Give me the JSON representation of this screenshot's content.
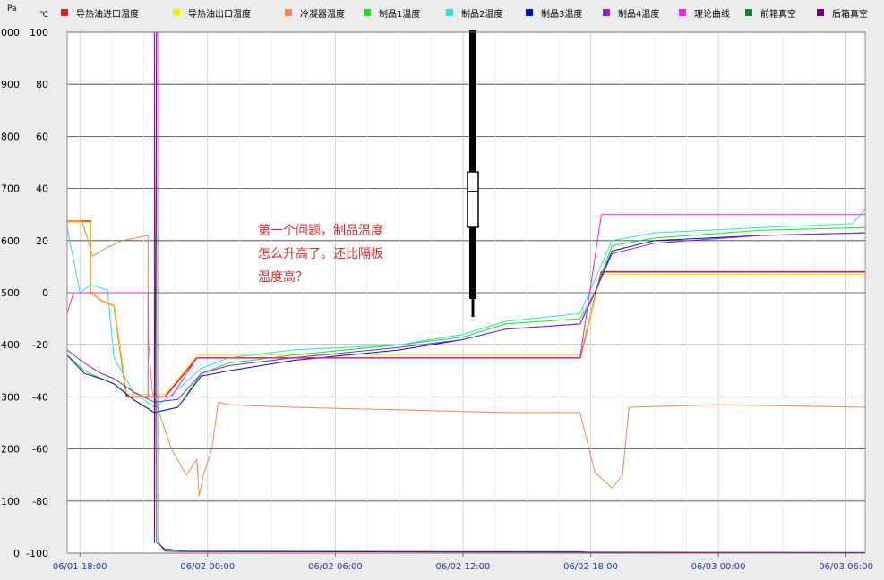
{
  "chart_data": {
    "type": "line",
    "units": {
      "left": "Pa",
      "right": "℃"
    },
    "legend": [
      {
        "name": "导热油进口温度",
        "color": "#e02020"
      },
      {
        "name": "导热油出口温度",
        "color": "#f0f000"
      },
      {
        "name": "冷凝器温度",
        "color": "#f08a50"
      },
      {
        "name": "制品1温度",
        "color": "#20e020"
      },
      {
        "name": "制品2温度",
        "color": "#30e0e0"
      },
      {
        "name": "制品3温度",
        "color": "#0010b0"
      },
      {
        "name": "制品4温度",
        "color": "#8a20e0"
      },
      {
        "name": "理论曲线",
        "color": "#f020f0"
      },
      {
        "name": "前箱真空",
        "color": "#108030"
      },
      {
        "name": "后箱真空",
        "color": "#7a007a"
      }
    ],
    "left_axis": {
      "label": "Pa",
      "ylim": [
        0,
        1000
      ],
      "ticks": [
        "0",
        "100",
        "200",
        "300",
        "400",
        "500",
        "600",
        "700",
        "800",
        "900",
        "1000"
      ]
    },
    "right_axis": {
      "label": "℃",
      "ylim": [
        -100,
        100
      ],
      "ticks": [
        "-100",
        "-80",
        "-60",
        "-40",
        "-20",
        "0",
        "20",
        "40",
        "60",
        "80",
        "100"
      ]
    },
    "x_ticks": [
      "06/01 18:00",
      "06/02 00:00",
      "06/02 06:00",
      "06/02 12:00",
      "06/02 18:00",
      "06/03 00:00",
      "06/03 06:00"
    ],
    "xlim_hours": [
      -0.6,
      36.9
    ],
    "grid": true,
    "annotation": {
      "lines": [
        "第一个问题，制品温度",
        "怎么升高了。还比隔板",
        "温度高？"
      ],
      "color": "#d23030"
    },
    "series": [
      {
        "name": "导热油进口温度",
        "color": "#e02020",
        "axis": "right",
        "points": [
          [
            -0.6,
            27.5
          ],
          [
            0.1,
            27.5
          ],
          [
            0.5,
            27.5
          ],
          [
            0.5,
            0
          ],
          [
            1.0,
            -3
          ],
          [
            1.6,
            -5
          ],
          [
            2.2,
            -40
          ],
          [
            3.2,
            -40
          ],
          [
            4.0,
            -40
          ],
          [
            5.5,
            -25
          ],
          [
            23.5,
            -25
          ],
          [
            24.5,
            8
          ],
          [
            36.9,
            8
          ]
        ]
      },
      {
        "name": "导热油出口温度",
        "color": "#f0f000",
        "axis": "right",
        "points": [
          [
            -0.6,
            27
          ],
          [
            0.1,
            27
          ],
          [
            0.5,
            27
          ],
          [
            0.5,
            0
          ],
          [
            1.0,
            -3
          ],
          [
            1.6,
            -5
          ],
          [
            2.2,
            -39
          ],
          [
            3.2,
            -39
          ],
          [
            4.0,
            -39
          ],
          [
            5.5,
            -24
          ],
          [
            23.5,
            -24
          ],
          [
            24.5,
            7
          ],
          [
            36.9,
            7
          ]
        ]
      },
      {
        "name": "冷凝器温度",
        "color": "#f08a50",
        "axis": "right",
        "points": [
          [
            -0.6,
            27.5
          ],
          [
            0.1,
            27.5
          ],
          [
            0.6,
            14
          ],
          [
            1.2,
            17
          ],
          [
            2.0,
            20
          ],
          [
            3.2,
            22
          ],
          [
            3.2,
            -16
          ],
          [
            3.4,
            -38
          ],
          [
            4.3,
            -60
          ],
          [
            5.0,
            -70
          ],
          [
            5.5,
            -64
          ],
          [
            5.6,
            -78
          ],
          [
            5.8,
            -70
          ],
          [
            6.2,
            -60
          ],
          [
            6.5,
            -42
          ],
          [
            7.0,
            -43
          ],
          [
            10,
            -44
          ],
          [
            15,
            -45
          ],
          [
            20,
            -46
          ],
          [
            23.5,
            -46
          ],
          [
            24.2,
            -69
          ],
          [
            25,
            -75
          ],
          [
            25.5,
            -70
          ],
          [
            25.8,
            -44
          ],
          [
            30,
            -43
          ],
          [
            36.9,
            -44
          ]
        ]
      },
      {
        "name": "制品1温度",
        "color": "#20e020",
        "axis": "right",
        "points": [
          [
            -0.6,
            -24
          ],
          [
            0.2,
            -30
          ],
          [
            1.0,
            -33
          ],
          [
            1.6,
            -35
          ],
          [
            2.5,
            -41
          ],
          [
            3.5,
            -46
          ],
          [
            4.6,
            -44
          ],
          [
            5.7,
            -31
          ],
          [
            7,
            -27
          ],
          [
            10,
            -24
          ],
          [
            15,
            -20
          ],
          [
            18,
            -17
          ],
          [
            20,
            -12
          ],
          [
            23.5,
            -10
          ],
          [
            24.2,
            0
          ],
          [
            25.0,
            18
          ],
          [
            27,
            21
          ],
          [
            32,
            24
          ],
          [
            36.9,
            25
          ]
        ]
      },
      {
        "name": "制品2温度",
        "color": "#30e0e0",
        "axis": "right",
        "points": [
          [
            -0.6,
            25
          ],
          [
            0.0,
            0
          ],
          [
            0.5,
            3
          ],
          [
            1.3,
            1
          ],
          [
            1.6,
            -25
          ],
          [
            2.5,
            -38
          ],
          [
            3.5,
            -44
          ],
          [
            4.2,
            -40
          ],
          [
            4.6,
            -37
          ],
          [
            5.7,
            -29
          ],
          [
            7,
            -25
          ],
          [
            10,
            -22
          ],
          [
            15,
            -20
          ],
          [
            18,
            -16
          ],
          [
            20,
            -11
          ],
          [
            23.5,
            -8
          ],
          [
            24.2,
            5
          ],
          [
            25.0,
            20
          ],
          [
            27,
            23
          ],
          [
            32,
            25
          ],
          [
            36.3,
            26.5
          ],
          [
            36.9,
            32
          ]
        ]
      },
      {
        "name": "制品3温度",
        "color": "#0010b0",
        "axis": "right",
        "points": [
          [
            -0.6,
            -24
          ],
          [
            0.2,
            -31
          ],
          [
            1.0,
            -33
          ],
          [
            1.6,
            -35
          ],
          [
            2.5,
            -41
          ],
          [
            3.5,
            -46
          ],
          [
            4.6,
            -44
          ],
          [
            5.7,
            -32
          ],
          [
            7,
            -30
          ],
          [
            10,
            -26
          ],
          [
            15,
            -22
          ],
          [
            18,
            -18
          ],
          [
            20,
            -14
          ],
          [
            23.5,
            -12
          ],
          [
            24.2,
            0
          ],
          [
            25.0,
            16
          ],
          [
            27,
            20
          ],
          [
            32,
            22
          ],
          [
            36.9,
            23
          ]
        ]
      },
      {
        "name": "制品4温度",
        "color": "#8a20e0",
        "axis": "right",
        "points": [
          [
            -0.6,
            -22
          ],
          [
            0.2,
            -27
          ],
          [
            1.0,
            -31
          ],
          [
            1.6,
            -33
          ],
          [
            2.5,
            -38
          ],
          [
            3.5,
            -42
          ],
          [
            4.6,
            -41
          ],
          [
            5.7,
            -31
          ],
          [
            7,
            -28
          ],
          [
            10,
            -25
          ],
          [
            15,
            -21
          ],
          [
            18,
            -18
          ],
          [
            20,
            -14
          ],
          [
            23.5,
            -12
          ],
          [
            24.2,
            0
          ],
          [
            25.0,
            15
          ],
          [
            27,
            19
          ],
          [
            32,
            22
          ],
          [
            36.9,
            23
          ]
        ]
      },
      {
        "name": "理论曲线",
        "color": "#f020f0",
        "axis": "right",
        "points": [
          [
            -0.6,
            -8
          ],
          [
            -0.3,
            0
          ],
          [
            3.2,
            0
          ],
          [
            3.2,
            -40
          ],
          [
            4.3,
            -40
          ],
          [
            5.5,
            -25
          ],
          [
            23.5,
            -25
          ],
          [
            24.5,
            30
          ],
          [
            36.9,
            30
          ]
        ]
      },
      {
        "name": "前箱真空",
        "color": "#108030",
        "axis": "left",
        "points": [
          [
            -0.6,
            1000
          ],
          [
            3.6,
            1000
          ],
          [
            3.6,
            20
          ],
          [
            4.0,
            8
          ],
          [
            5.0,
            4
          ],
          [
            20,
            3
          ],
          [
            23.5,
            3
          ],
          [
            24.0,
            1
          ],
          [
            36.9,
            1
          ]
        ]
      },
      {
        "name": "后箱真空",
        "color": "#7a007a",
        "axis": "left",
        "points": [
          [
            -0.6,
            1000
          ],
          [
            3.5,
            1000
          ],
          [
            3.5,
            20
          ],
          [
            3.6,
            1000
          ],
          [
            3.7,
            1000
          ],
          [
            3.7,
            20
          ],
          [
            4.0,
            4
          ],
          [
            5.0,
            3
          ],
          [
            20,
            2
          ],
          [
            36.9,
            1
          ]
        ]
      }
    ]
  }
}
